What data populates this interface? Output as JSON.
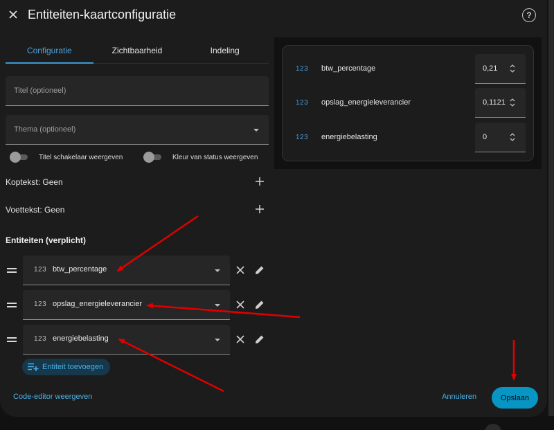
{
  "dialog": {
    "title": "Entiteiten-kaartconfiguratie"
  },
  "tabs": [
    {
      "label": "Configuratie",
      "active": true
    },
    {
      "label": "Zichtbaarheid",
      "active": false
    },
    {
      "label": "Indeling",
      "active": false
    }
  ],
  "form": {
    "title_placeholder": "Titel (optioneel)",
    "theme_placeholder": "Thema (optioneel)",
    "toggle_title_label": "Titel schakelaar weergeven",
    "status_color_label": "Kleur van status weergeven",
    "header_label": "Koptekst: Geen",
    "footer_label": "Voettekst: Geen",
    "entities_title": "Entiteiten (verplicht)",
    "entities": [
      {
        "icon": "123",
        "name": "btw_percentage"
      },
      {
        "icon": "123",
        "name": "opslag_energieleverancier"
      },
      {
        "icon": "123",
        "name": "energiebelasting"
      }
    ],
    "add_entity_label": "Entiteit toevoegen"
  },
  "footer": {
    "code_editor_label": "Code-editor weergeven",
    "cancel_label": "Annuleren",
    "save_label": "Opslaan"
  },
  "preview": {
    "rows": [
      {
        "icon": "123",
        "name": "btw_percentage",
        "value": "0,21"
      },
      {
        "icon": "123",
        "name": "opslag_energieleverancier",
        "value": "0,1121"
      },
      {
        "icon": "123",
        "name": "energiebelasting",
        "value": "0"
      }
    ]
  },
  "colors": {
    "accent": "#4ab0e6",
    "save_button": "#0795c4",
    "annotation_arrows": "#e00000"
  },
  "icons": [
    "close-icon",
    "help-icon",
    "plus-icon",
    "drag-handle-icon",
    "remove-icon",
    "edit-icon",
    "add-list-icon",
    "spinner-icon",
    "chevron-down-icon"
  ]
}
